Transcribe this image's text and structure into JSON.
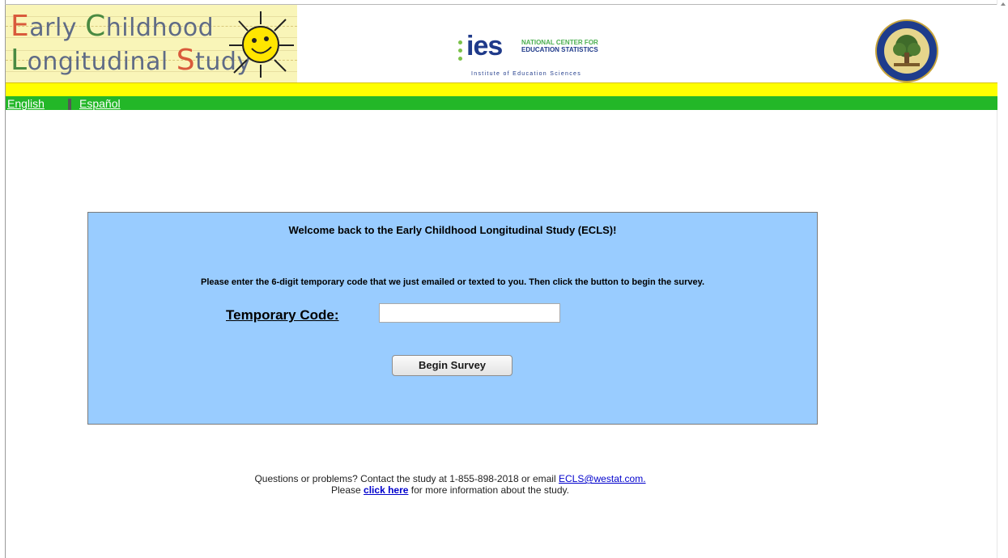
{
  "header": {
    "ecls_logo_text": [
      "Early Childhood",
      "Longitudinal Study"
    ],
    "ies_logo": {
      "word": "ies",
      "national_center": "NATIONAL CENTER FOR",
      "education_statistics": "EDUCATION STATISTICS",
      "institute": "Institute of Education Sciences"
    },
    "seal_name": "department-of-education-seal-icon"
  },
  "language_bar": {
    "english": "English",
    "espanol": "Español"
  },
  "panel": {
    "welcome": "Welcome back to the Early Childhood Longitudinal Study (ECLS)!",
    "instructions": "Please enter the 6-digit temporary code that we just emailed or texted to you. Then click the button to begin the survey.",
    "code_label": "Temporary Code:",
    "code_value": "",
    "begin_button": "Begin Survey"
  },
  "footer": {
    "line1_prefix": "Questions or problems? Contact the study at 1-855-898-2018 or email ",
    "email": "ECLS@westat.com.",
    "line2_prefix": "Please ",
    "click_here": "click here",
    "line2_suffix": " for more information about the study."
  },
  "colors": {
    "panel_bg": "#99ccff",
    "yellow_bar": "#ffff00",
    "green_bar": "#23b728",
    "logo_bg": "#f9f5b8",
    "link": "#0000cc"
  }
}
